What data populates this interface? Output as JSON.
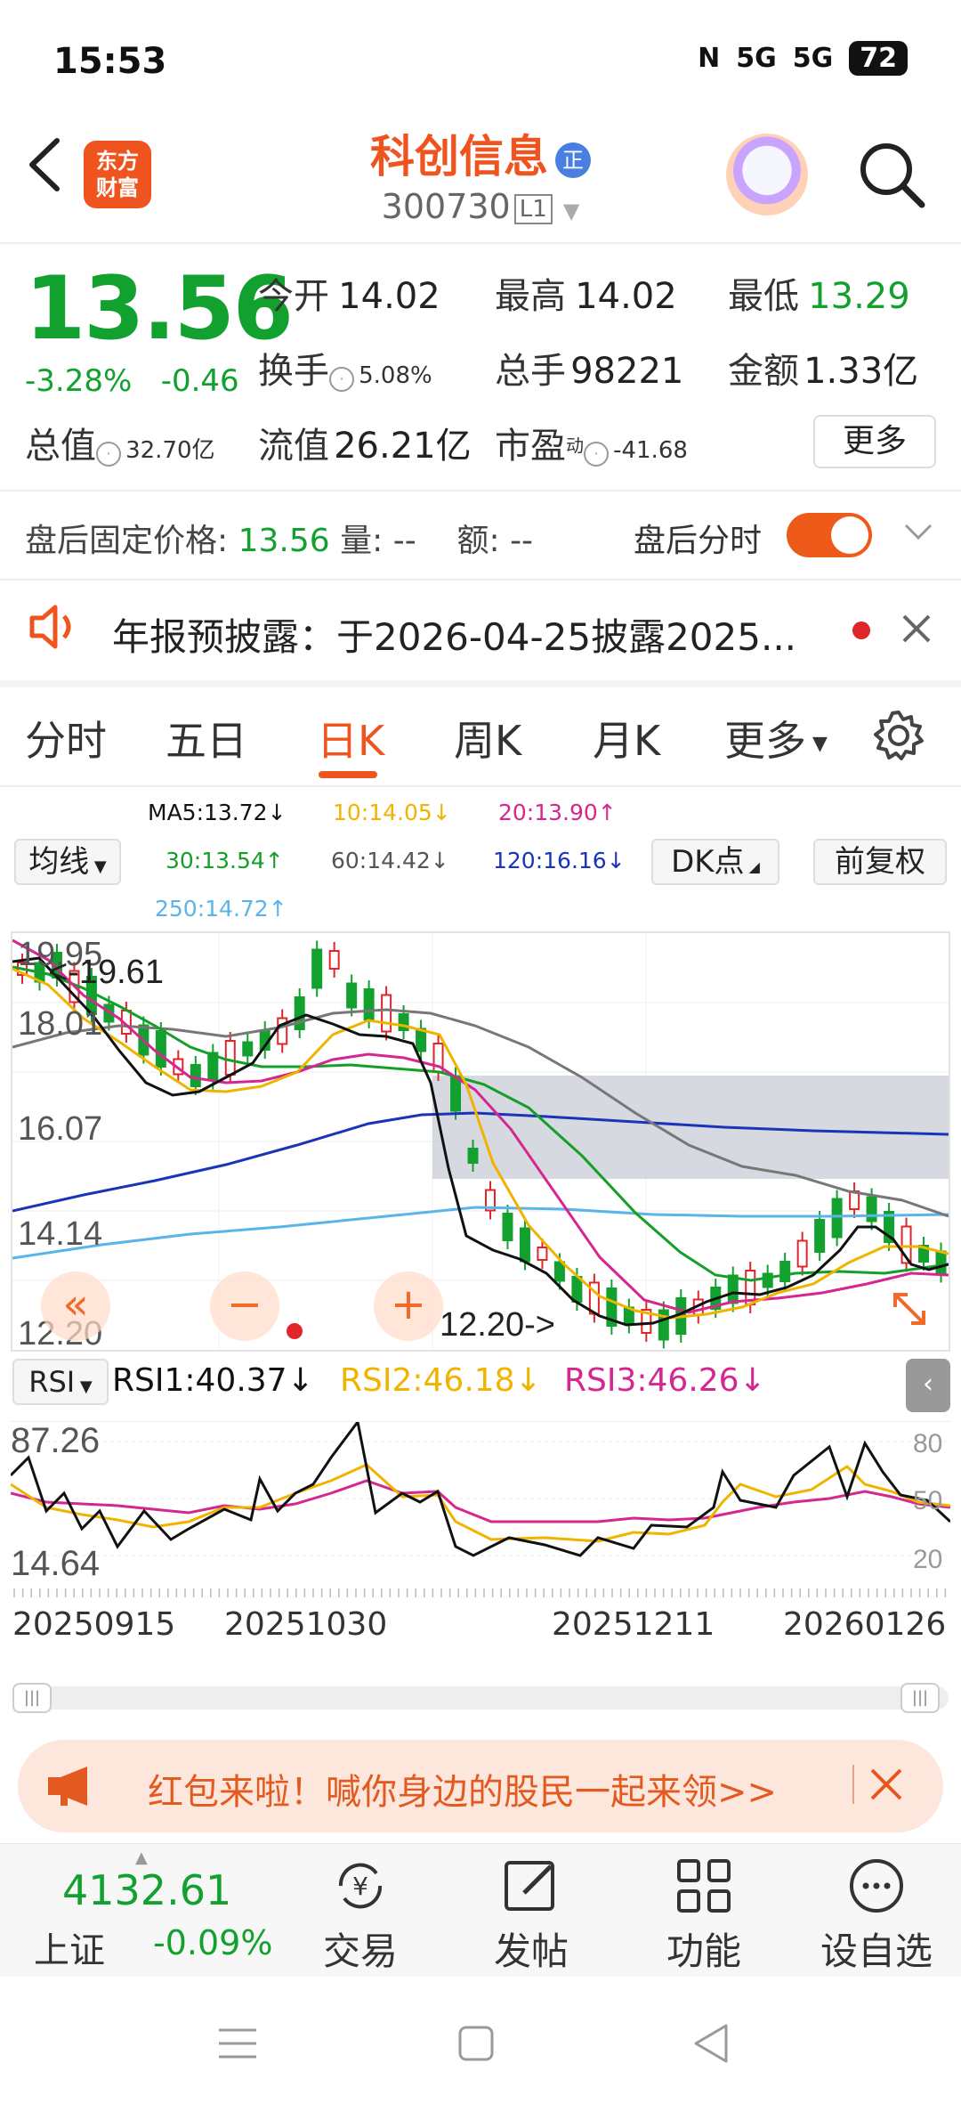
{
  "status": {
    "time": "15:53",
    "network1": "5G",
    "network2": "5G",
    "battery": "72"
  },
  "header": {
    "logo_top": "东方",
    "logo_bottom": "财富",
    "stock_name": "科创信息",
    "badge": "正",
    "code": "300730",
    "level": "L1"
  },
  "quote": {
    "price": "13.56",
    "change_pct": "-3.28%",
    "change": "-0.46",
    "open_label": "今开",
    "open": "14.02",
    "high_label": "最高",
    "high": "14.02",
    "low_label": "最低",
    "low": "13.29",
    "turnover_label": "换手",
    "turnover": "5.08%",
    "volume_label": "总手",
    "volume": "98221",
    "amount_label": "金额",
    "amount": "1.33亿",
    "mktcap_label": "总值",
    "mktcap": "32.70亿",
    "float_label": "流值",
    "float": "26.21亿",
    "pe_label": "市盈",
    "pe_super": "动",
    "pe": "-41.68",
    "more": "更多"
  },
  "after_hours": {
    "label": "盘后固定价格:",
    "price": "13.56",
    "vol_label": "量:",
    "vol": "--",
    "amt_label": "额:",
    "amt": "--",
    "toggle_label": "盘后分时",
    "toggle_on": true
  },
  "notice": {
    "text": "年报预披露：于2026-04-25披露2025..."
  },
  "tabs": [
    "分时",
    "五日",
    "日K",
    "周K",
    "月K",
    "更多"
  ],
  "active_tab": 2,
  "ma_legend": {
    "ma5": "MA5:13.72↓",
    "ma10": "10:14.05↓",
    "ma20": "20:13.90↑",
    "ma30": "30:13.54↑",
    "ma60": "60:14.42↓",
    "ma120": "120:16.16↓",
    "ma250": "250:14.72↑",
    "select_label": "均线",
    "dk_label": "DK点",
    "adj_label": "前复权"
  },
  "colors": {
    "accent": "#f0541e",
    "down": "#12a12e",
    "up": "#e0262b",
    "ma5": "#111111",
    "ma10": "#f0b400",
    "ma20": "#d6268f",
    "ma30": "#14a028",
    "ma60": "#777777",
    "ma120": "#1a34b8",
    "ma250": "#5ab4e8"
  },
  "chart": {
    "y_labels": [
      "19.95",
      "18.01",
      "16.07",
      "14.14",
      "12.20"
    ],
    "high_marker": "19.61",
    "low_marker": "12.20->"
  },
  "rsi": {
    "select": "RSI",
    "rsi1": "RSI1:40.37↓",
    "rsi2": "RSI2:46.18↓",
    "rsi3": "RSI3:46.26↓",
    "y_left": [
      "87.26",
      "14.64"
    ],
    "y_right": [
      "80",
      "50",
      "20"
    ]
  },
  "dates": [
    "20250915",
    "20251030",
    "20251211",
    "20260126"
  ],
  "promo": {
    "text": "红包来啦！喊你身边的股民一起来领>>"
  },
  "bottom": {
    "index_value": "4132.61",
    "index_name": "上证",
    "index_change": "-0.09%",
    "trade": "交易",
    "post": "发帖",
    "features": "功能",
    "watchlist": "设自选"
  }
}
